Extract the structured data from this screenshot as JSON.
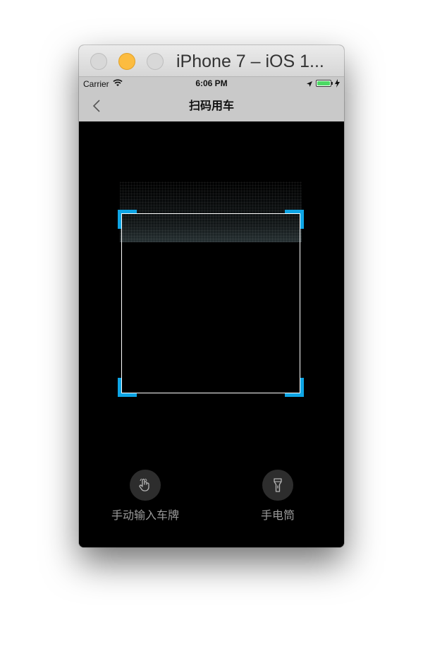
{
  "window": {
    "title": "iPhone 7 – iOS 1..."
  },
  "status_bar": {
    "carrier": "Carrier",
    "time": "6:06 PM",
    "battery_color": "#4cd964"
  },
  "nav_bar": {
    "back_icon": "chevron-left-icon",
    "title": "扫码用车"
  },
  "scanner": {
    "frame_color": "#ffffff",
    "corner_color": "#0ea5e5"
  },
  "actions": {
    "manual_entry": {
      "icon": "hand-tap-icon",
      "label": "手动输入车牌"
    },
    "flashlight": {
      "icon": "flashlight-icon",
      "label": "手电筒"
    }
  }
}
